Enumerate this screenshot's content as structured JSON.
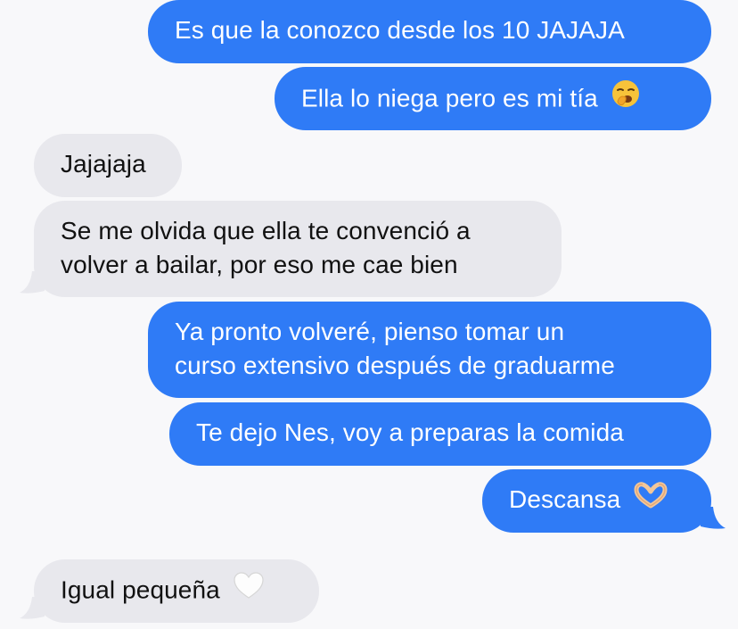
{
  "conversation": {
    "messages": [
      {
        "direction": "sent",
        "text": "Es que la conozco desde los 10 JAJAJA"
      },
      {
        "direction": "sent",
        "text": "Ella lo niega pero es mi tía",
        "emoji": "yawning-face-icon"
      },
      {
        "direction": "received",
        "text": "Jajajaja"
      },
      {
        "direction": "received",
        "lines": [
          "Se me olvida que ella te convenció a",
          "volver a bailar, por eso me cae bien"
        ]
      },
      {
        "direction": "sent",
        "lines": [
          "Ya pronto volveré, pienso tomar un",
          "curso extensivo después de graduarme"
        ]
      },
      {
        "direction": "sent",
        "text": "Te dejo Nes, voy a preparas la comida"
      },
      {
        "direction": "sent",
        "text": "Descansa",
        "emoji": "heart-hands-icon"
      },
      {
        "direction": "received",
        "text": "Igual pequeña",
        "emoji": "white-heart-icon"
      }
    ]
  },
  "colors": {
    "sent_bubble": "#2f7bf6",
    "received_bubble": "#e8e8ed",
    "background": "#f8f8fa"
  }
}
